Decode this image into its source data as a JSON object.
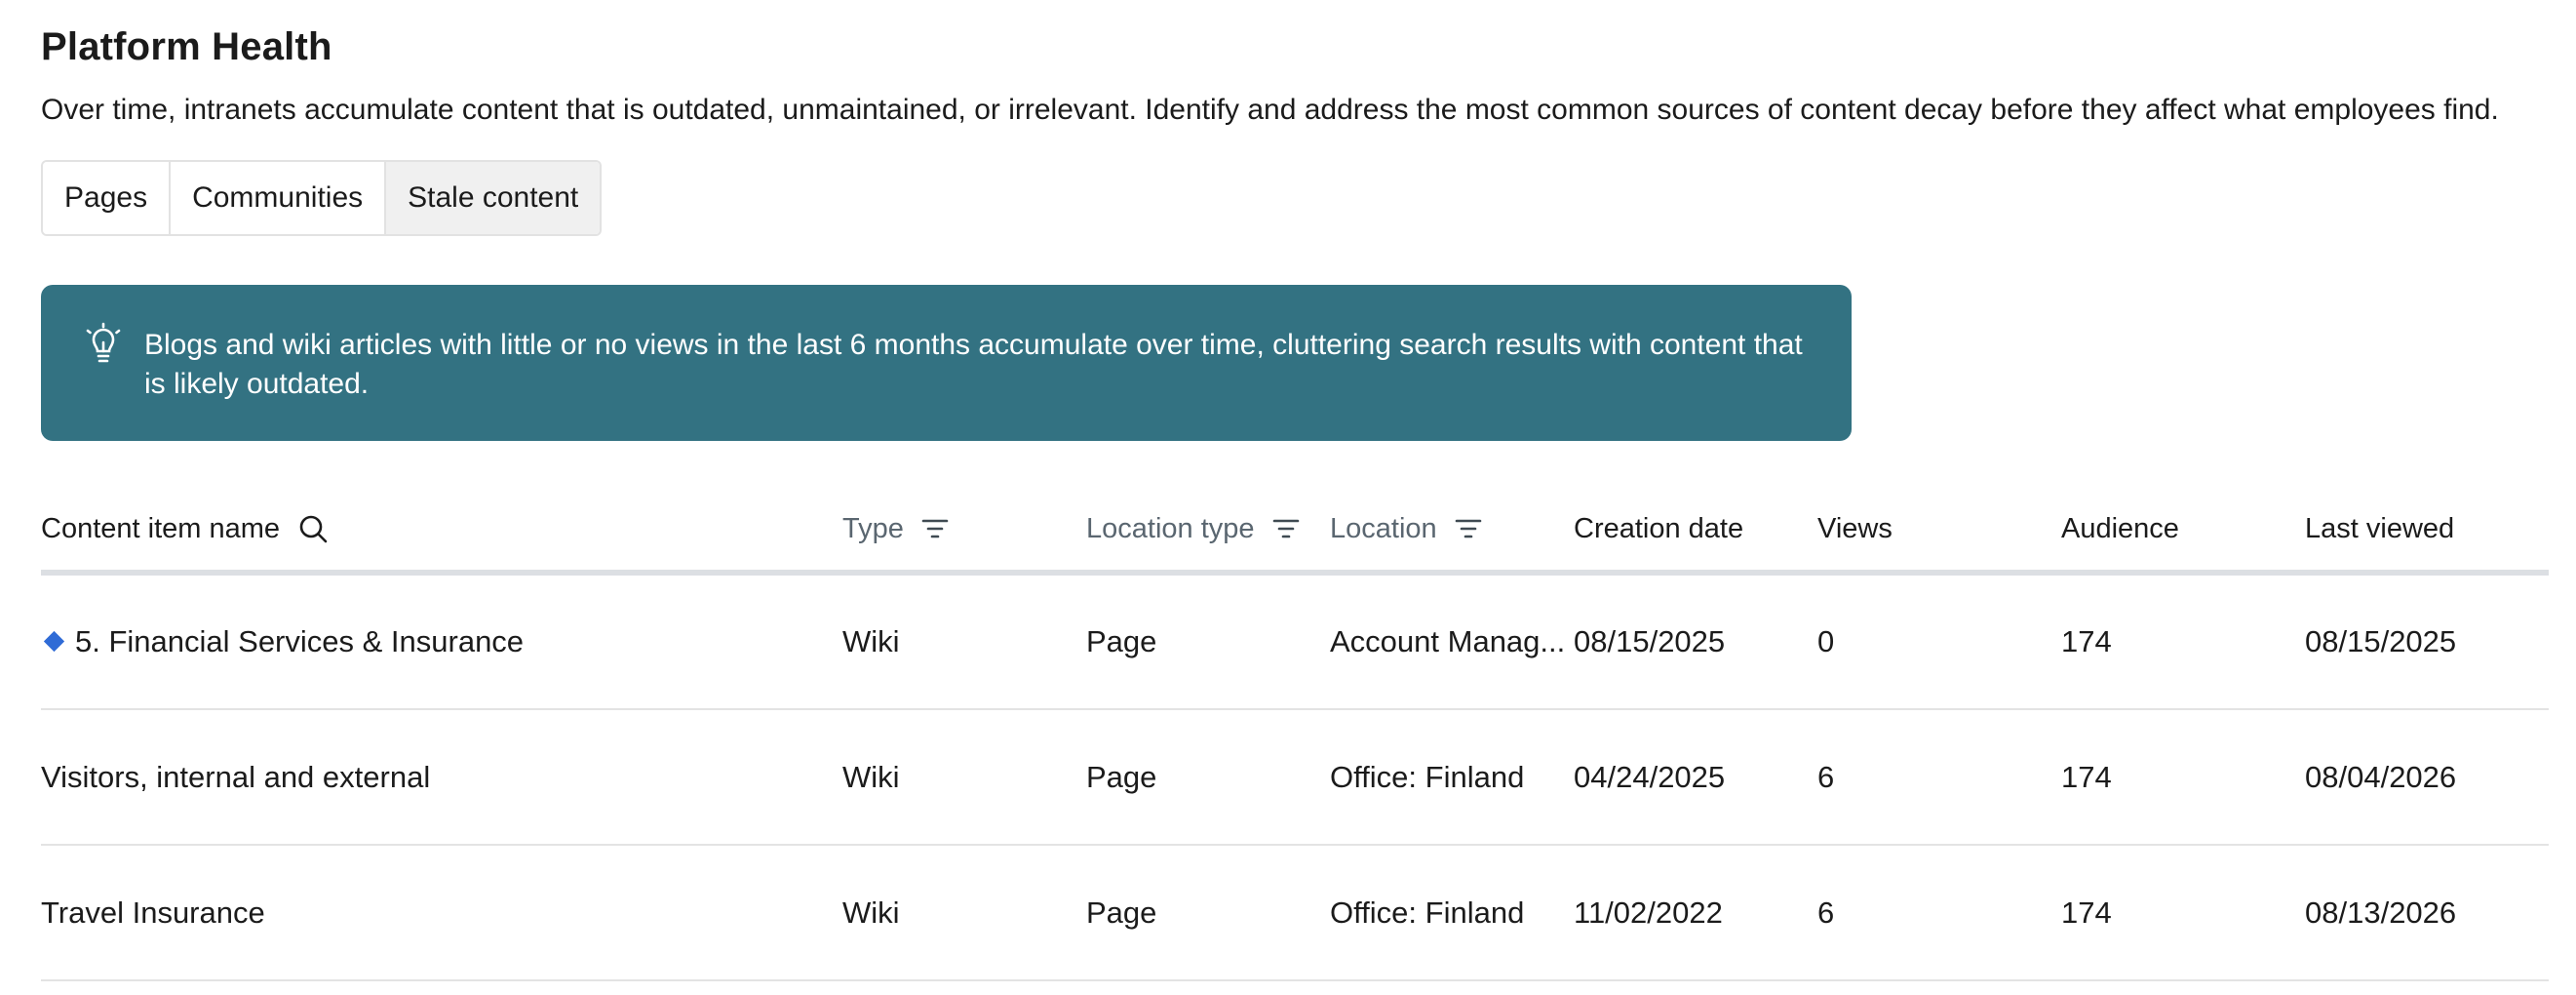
{
  "header": {
    "title": "Platform Health",
    "subtitle": "Over time, intranets accumulate content that is outdated, unmaintained, or irrelevant. Identify and address the most common sources of content decay before they affect what employees find."
  },
  "tabs": [
    {
      "label": "Pages",
      "active": false
    },
    {
      "label": "Communities",
      "active": false
    },
    {
      "label": "Stale content",
      "active": true
    }
  ],
  "banner": {
    "icon": "lightbulb-icon",
    "text": "Blogs and wiki articles with little or no views in the last 6 months accumulate over time, cluttering search results with content that is likely outdated.",
    "background": "#337282"
  },
  "table": {
    "columns": {
      "name": "Content item name",
      "type": "Type",
      "location_type": "Location type",
      "location": "Location",
      "creation_date": "Creation date",
      "views": "Views",
      "audience": "Audience",
      "last_viewed": "Last viewed"
    },
    "rows": [
      {
        "name": "5. Financial Services & Insurance",
        "type": "Wiki",
        "location_type": "Page",
        "location": "Account Manag...",
        "creation_date": "08/15/2025",
        "views": "0",
        "audience": "174",
        "last_viewed": "08/15/2025"
      },
      {
        "name": "Visitors, internal and external",
        "type": "Wiki",
        "location_type": "Page",
        "location": "Office: Finland",
        "creation_date": "04/24/2025",
        "views": "6",
        "audience": "174",
        "last_viewed": "08/04/2026"
      },
      {
        "name": "Travel Insurance",
        "type": "Wiki",
        "location_type": "Page",
        "location": "Office: Finland",
        "creation_date": "11/02/2022",
        "views": "6",
        "audience": "174",
        "last_viewed": "08/13/2026"
      }
    ]
  },
  "colors": {
    "banner": "#337282",
    "row_marker": "#2f6bd6"
  }
}
